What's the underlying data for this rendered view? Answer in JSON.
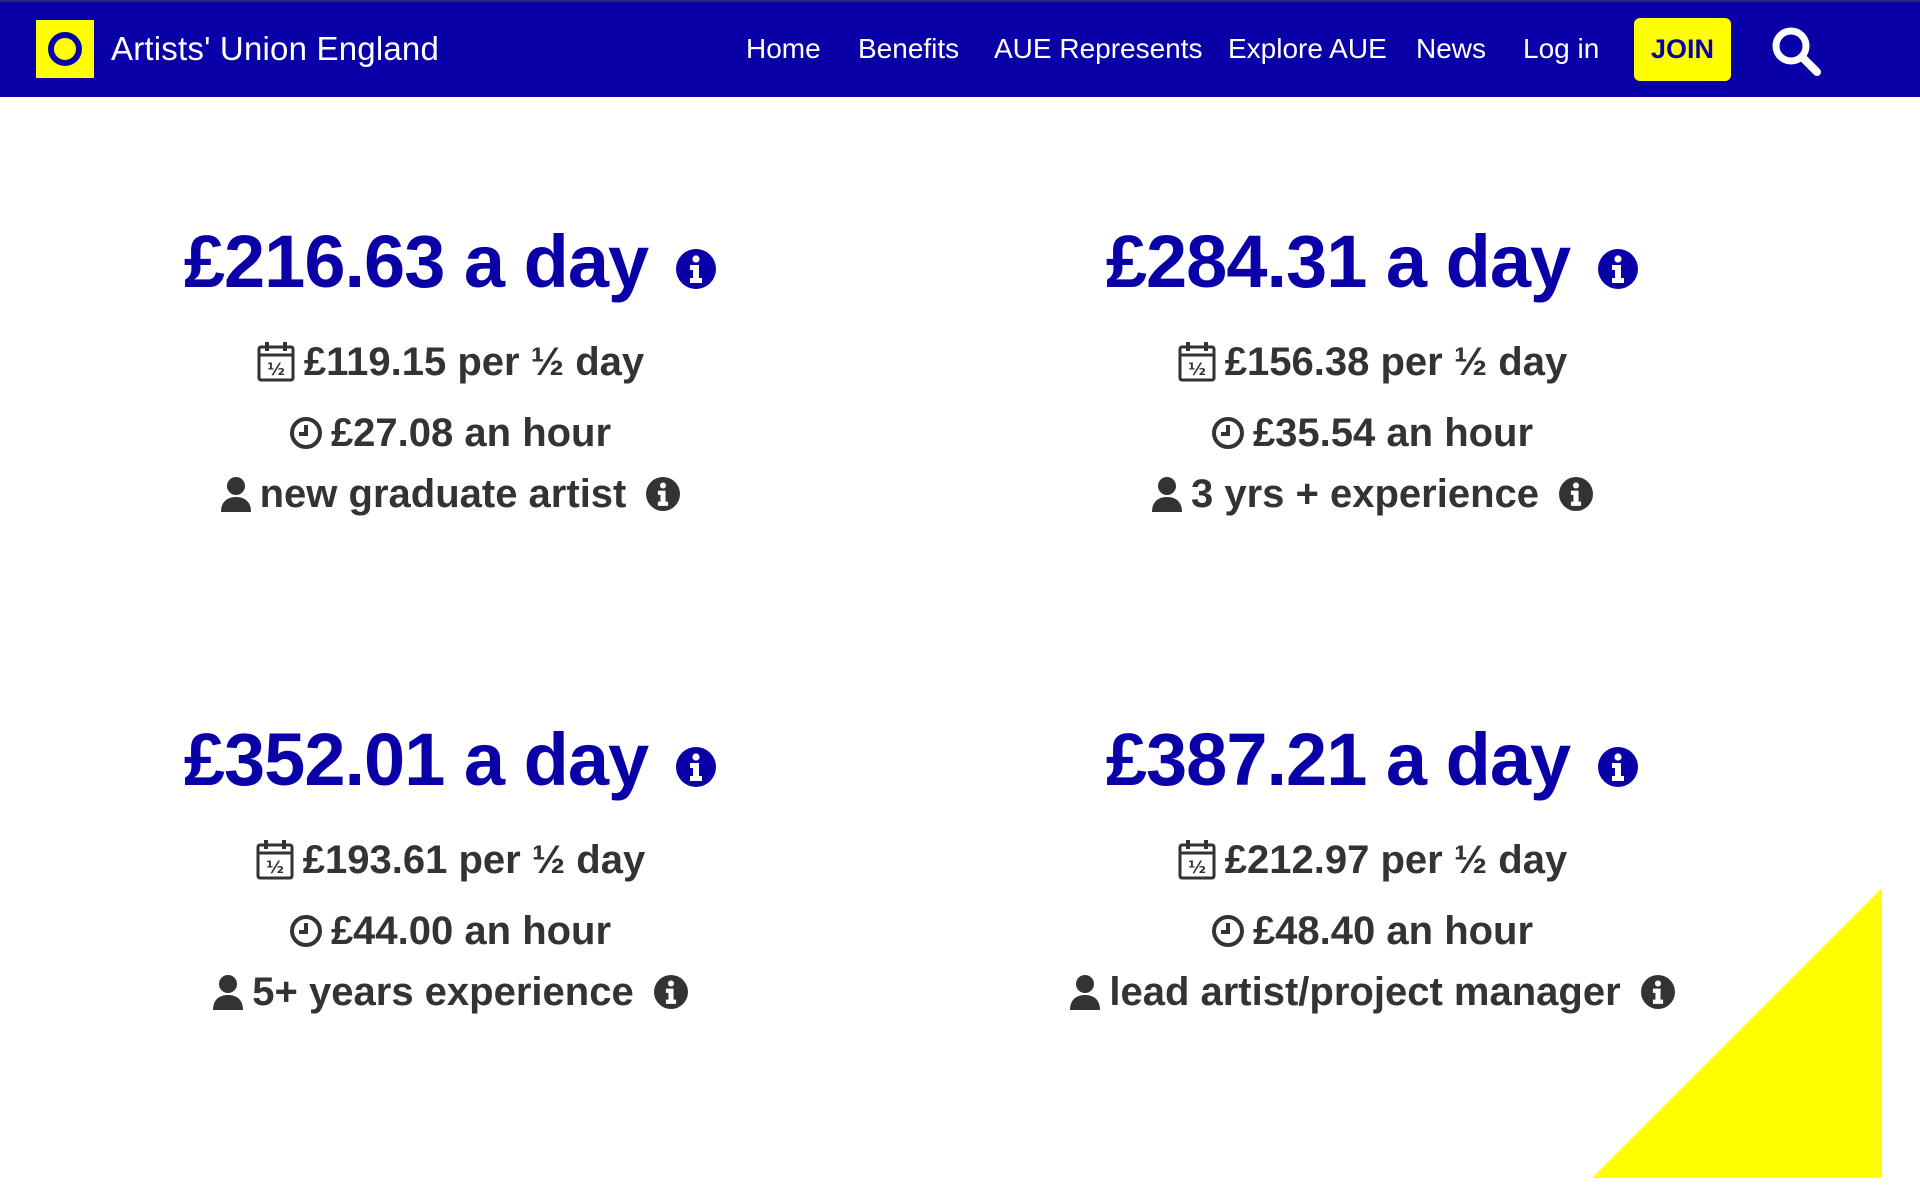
{
  "header": {
    "brand_name": "Artists' Union England",
    "nav": [
      {
        "label": "Home"
      },
      {
        "label": "Benefits"
      },
      {
        "label": "AUE Represents"
      },
      {
        "label": "Explore AUE"
      },
      {
        "label": "News"
      },
      {
        "label": "Log in"
      }
    ],
    "join_label": "JOIN"
  },
  "colors": {
    "brand_blue": "#0a00a8",
    "accent_yellow": "#ffff00",
    "text_dark": "#333333"
  },
  "rates": [
    {
      "day_rate": "£216.63 a day",
      "half_day": "£119.15 per ½ day",
      "hourly": "£27.08 an hour",
      "level": "new graduate artist"
    },
    {
      "day_rate": "£284.31 a day",
      "half_day": "£156.38 per ½ day",
      "hourly": "£35.54 an hour",
      "level": "3 yrs + experience"
    },
    {
      "day_rate": "£352.01 a day",
      "half_day": "£193.61 per ½ day",
      "hourly": "£44.00 an hour",
      "level": "5+ years experience"
    },
    {
      "day_rate": "£387.21 a day",
      "half_day": "£212.97 per ½ day",
      "hourly": "£48.40 an hour",
      "level": "lead artist/project manager"
    }
  ],
  "icons": {
    "info": "info-icon",
    "calendar_half": "calendar-half-icon",
    "clock": "clock-icon",
    "person": "person-icon",
    "search": "search-icon",
    "half_glyph": "½"
  }
}
